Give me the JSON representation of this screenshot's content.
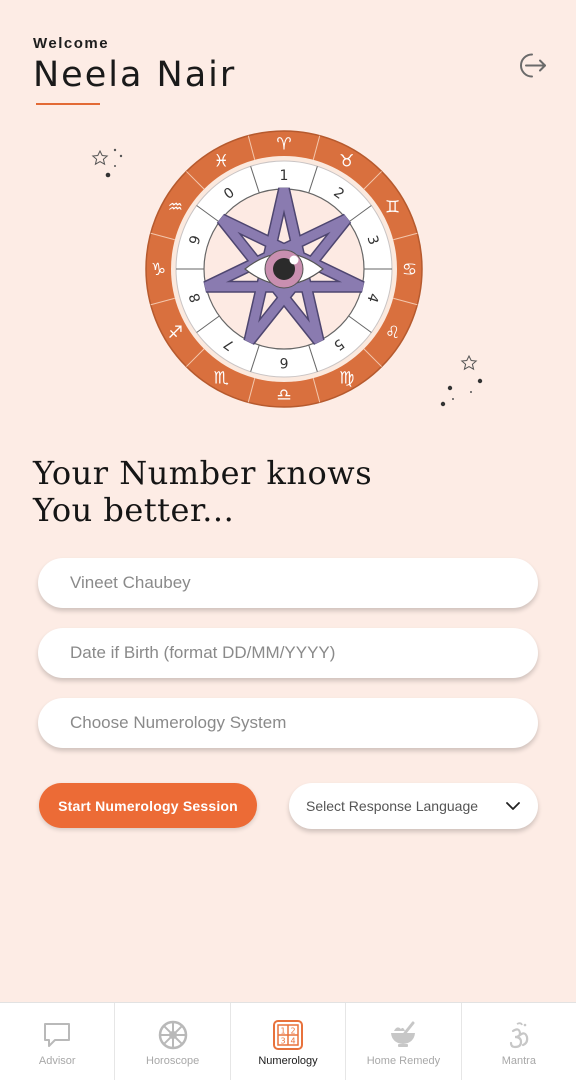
{
  "header": {
    "welcome": "Welcome",
    "user_name": "Neela Nair"
  },
  "icons": {
    "logout": "logout-icon"
  },
  "wheel": {
    "zodiac_symbols": [
      "♈",
      "♉",
      "♊",
      "♋",
      "♌",
      "♍",
      "♎",
      "♏",
      "♐",
      "♑",
      "♒",
      "♓"
    ],
    "numbers": [
      "1",
      "2",
      "3",
      "4",
      "5",
      "6",
      "7",
      "8",
      "9",
      "0"
    ],
    "colors": {
      "outer_ring": "#d9703e",
      "star": "#8a7bb0",
      "eye": "#c98fb0"
    }
  },
  "tagline": {
    "line1": "Your Number knows",
    "line2": "You better..."
  },
  "form": {
    "name_value": "Vineet Chaubey",
    "dob_placeholder": "Date if Birth (format DD/MM/YYYY)",
    "system_placeholder": "Choose Numerology System",
    "start_label": "Start Numerology Session",
    "language_placeholder": "Select Response Language"
  },
  "colors": {
    "background": "#fdece5",
    "accent": "#ec6b36"
  },
  "nav": {
    "items": [
      {
        "label": "Advisor",
        "icon": "chat-bubble-icon"
      },
      {
        "label": "Horoscope",
        "icon": "wheel-icon"
      },
      {
        "label": "Numerology",
        "icon": "number-grid-icon"
      },
      {
        "label": "Home Remedy",
        "icon": "mortar-pestle-icon"
      },
      {
        "label": "Mantra",
        "icon": "om-icon"
      }
    ],
    "active": "Numerology"
  }
}
